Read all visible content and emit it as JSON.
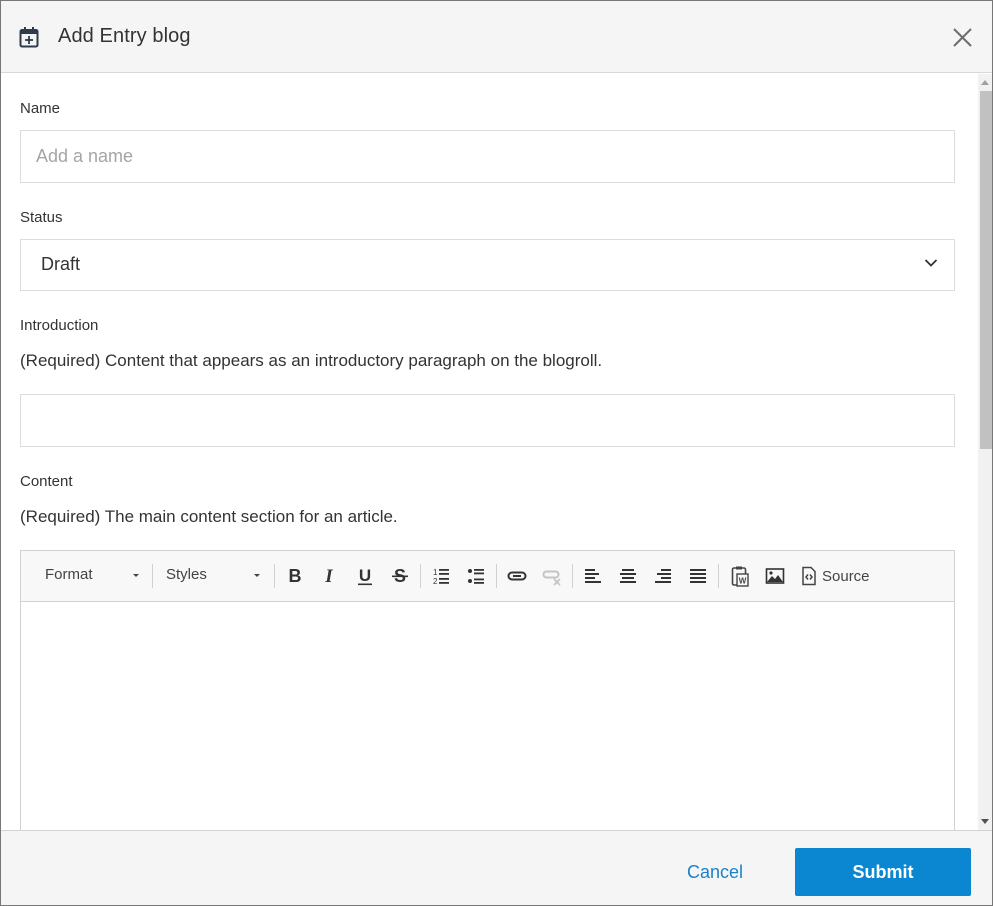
{
  "dialog": {
    "title": "Add Entry blog",
    "title_icon": "calendar-plus-icon",
    "close_icon": "close-icon"
  },
  "form": {
    "name": {
      "label": "Name",
      "value": "",
      "placeholder": "Add a name"
    },
    "status": {
      "label": "Status",
      "selected": "Draft",
      "icon": "chevron-down-icon"
    },
    "introduction": {
      "label": "Introduction",
      "help": "(Required) Content that appears as an introductory paragraph on the blogroll.",
      "value": ""
    },
    "content": {
      "label": "Content",
      "help": "(Required) The main content section for an article.",
      "value": ""
    }
  },
  "editor_toolbar": {
    "format_label": "Format",
    "styles_label": "Styles",
    "buttons": [
      {
        "name": "bold",
        "icon": "bold-icon"
      },
      {
        "name": "italic",
        "icon": "italic-icon"
      },
      {
        "name": "underline",
        "icon": "underline-icon"
      },
      {
        "name": "strikethrough",
        "icon": "strikethrough-icon"
      },
      {
        "name": "numbered-list",
        "icon": "numbered-list-icon"
      },
      {
        "name": "bulleted-list",
        "icon": "bulleted-list-icon"
      },
      {
        "name": "link",
        "icon": "link-icon"
      },
      {
        "name": "unlink",
        "icon": "unlink-icon",
        "disabled": true
      },
      {
        "name": "align-left",
        "icon": "align-left-icon"
      },
      {
        "name": "align-center",
        "icon": "align-center-icon"
      },
      {
        "name": "align-right",
        "icon": "align-right-icon"
      },
      {
        "name": "justify",
        "icon": "justify-icon"
      },
      {
        "name": "paste-from-word",
        "icon": "paste-word-icon"
      },
      {
        "name": "image",
        "icon": "image-icon"
      }
    ],
    "source_label": "Source"
  },
  "footer": {
    "cancel_label": "Cancel",
    "submit_label": "Submit"
  },
  "colors": {
    "accent": "#0a87d0",
    "link": "#1a82c8",
    "header_bg": "#f5f5f5"
  }
}
